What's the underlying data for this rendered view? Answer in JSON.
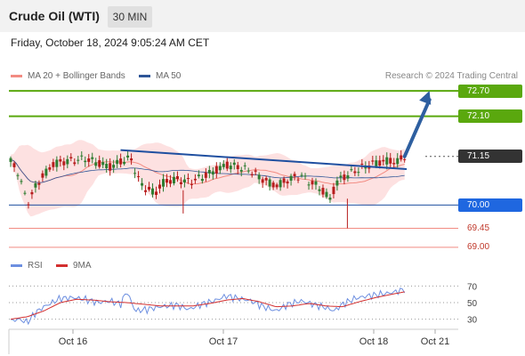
{
  "header": {
    "title": "Crude Oil (WTI)",
    "timeframe": "30 MIN"
  },
  "datetime": "Friday, October 18, 2024 9:05:24 AM CET",
  "legend": {
    "ma20_label": "MA 20 + Bollinger Bands",
    "ma50_label": "MA 50",
    "credit": "Research © 2024 Trading Central"
  },
  "rsi_legend": {
    "rsi_label": "RSI",
    "ma_label": "9MA"
  },
  "colors": {
    "ma20": "#f28b82",
    "ma50": "#2e5597",
    "resistance": "#5aa80e",
    "support": "#1f67e0",
    "support_line": "#1f4fa0",
    "weak_support": "#f28b82",
    "current": "#333333",
    "bull": "#2e7d32",
    "bear": "#b71c1c",
    "rsi": "#6d8fe0",
    "rsi_ma": "#d32f2f",
    "band": "#fde1e1",
    "arrow": "#2e5fa0"
  },
  "chart_data": {
    "type": "candlestick",
    "instrument": "Crude Oil (WTI)",
    "interval": "30 MIN",
    "price_axis": {
      "ylim": [
        68.85,
        72.85
      ]
    },
    "x_ticks": [
      "Oct 16",
      "Oct 17",
      "Oct 18",
      "Oct 21"
    ],
    "levels": [
      {
        "label": "72.70",
        "value": 72.7,
        "kind": "resistance"
      },
      {
        "label": "72.10",
        "value": 72.1,
        "kind": "resistance"
      },
      {
        "label": "71.15",
        "value": 71.15,
        "kind": "current"
      },
      {
        "label": "70.00",
        "value": 70.0,
        "kind": "support"
      },
      {
        "label": "69.45",
        "value": 69.45,
        "kind": "weak-support"
      },
      {
        "label": "69.00",
        "value": 69.0,
        "kind": "weak-support"
      }
    ],
    "trendline": {
      "from": [
        0.265,
        71.3
      ],
      "to": [
        0.955,
        70.85
      ]
    },
    "forecast_arrow": {
      "from": [
        0.95,
        71.15
      ],
      "to": [
        1.01,
        72.7
      ]
    },
    "price_path": [
      [
        0.0,
        71.02
      ],
      [
        0.015,
        70.85
      ],
      [
        0.03,
        70.35
      ],
      [
        0.045,
        70.05
      ],
      [
        0.06,
        70.45
      ],
      [
        0.08,
        70.7
      ],
      [
        0.1,
        70.95
      ],
      [
        0.12,
        71.02
      ],
      [
        0.15,
        71.05
      ],
      [
        0.18,
        71.1
      ],
      [
        0.21,
        71.0
      ],
      [
        0.24,
        70.9
      ],
      [
        0.27,
        71.05
      ],
      [
        0.29,
        71.1
      ],
      [
        0.31,
        70.55
      ],
      [
        0.33,
        70.35
      ],
      [
        0.35,
        70.3
      ],
      [
        0.37,
        70.55
      ],
      [
        0.4,
        70.6
      ],
      [
        0.43,
        70.55
      ],
      [
        0.46,
        70.65
      ],
      [
        0.49,
        70.8
      ],
      [
        0.52,
        70.95
      ],
      [
        0.55,
        70.9
      ],
      [
        0.58,
        70.8
      ],
      [
        0.61,
        70.6
      ],
      [
        0.64,
        70.45
      ],
      [
        0.67,
        70.6
      ],
      [
        0.7,
        70.7
      ],
      [
        0.72,
        70.55
      ],
      [
        0.74,
        70.45
      ],
      [
        0.755,
        70.3
      ],
      [
        0.77,
        70.15
      ],
      [
        0.79,
        70.6
      ],
      [
        0.82,
        70.75
      ],
      [
        0.85,
        70.9
      ],
      [
        0.88,
        71.0
      ],
      [
        0.91,
        71.05
      ],
      [
        0.93,
        71.0
      ],
      [
        0.95,
        71.15
      ]
    ],
    "rsi": {
      "levels": [
        70,
        50,
        30
      ],
      "ylim": [
        20,
        80
      ],
      "rsi_path": [
        [
          0.0,
          28
        ],
        [
          0.02,
          30
        ],
        [
          0.04,
          26
        ],
        [
          0.06,
          38
        ],
        [
          0.08,
          45
        ],
        [
          0.1,
          50
        ],
        [
          0.12,
          55
        ],
        [
          0.15,
          56
        ],
        [
          0.18,
          54
        ],
        [
          0.21,
          50
        ],
        [
          0.24,
          52
        ],
        [
          0.265,
          48
        ],
        [
          0.28,
          64
        ],
        [
          0.3,
          40
        ],
        [
          0.33,
          42
        ],
        [
          0.36,
          45
        ],
        [
          0.4,
          47
        ],
        [
          0.43,
          42
        ],
        [
          0.46,
          48
        ],
        [
          0.49,
          52
        ],
        [
          0.52,
          58
        ],
        [
          0.55,
          55
        ],
        [
          0.58,
          52
        ],
        [
          0.61,
          45
        ],
        [
          0.64,
          40
        ],
        [
          0.67,
          48
        ],
        [
          0.7,
          52
        ],
        [
          0.73,
          48
        ],
        [
          0.76,
          44
        ],
        [
          0.78,
          40
        ],
        [
          0.8,
          48
        ],
        [
          0.83,
          55
        ],
        [
          0.86,
          58
        ],
        [
          0.89,
          60
        ],
        [
          0.92,
          62
        ],
        [
          0.95,
          66
        ]
      ],
      "ma_path": [
        [
          0.0,
          30
        ],
        [
          0.04,
          33
        ],
        [
          0.08,
          40
        ],
        [
          0.12,
          50
        ],
        [
          0.16,
          54
        ],
        [
          0.2,
          53
        ],
        [
          0.24,
          51
        ],
        [
          0.28,
          50
        ],
        [
          0.32,
          48
        ],
        [
          0.36,
          46
        ],
        [
          0.4,
          46
        ],
        [
          0.44,
          46
        ],
        [
          0.48,
          49
        ],
        [
          0.52,
          53
        ],
        [
          0.56,
          55
        ],
        [
          0.6,
          51
        ],
        [
          0.64,
          45
        ],
        [
          0.68,
          46
        ],
        [
          0.72,
          49
        ],
        [
          0.76,
          46
        ],
        [
          0.8,
          45
        ],
        [
          0.84,
          51
        ],
        [
          0.88,
          56
        ],
        [
          0.92,
          60
        ],
        [
          0.95,
          63
        ]
      ]
    }
  }
}
